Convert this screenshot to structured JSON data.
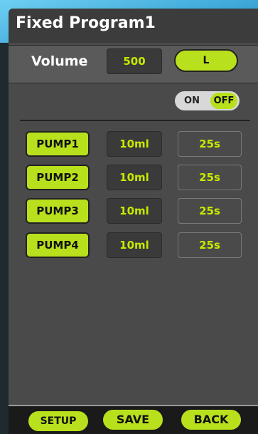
{
  "header": {
    "title": "Fixed Program1"
  },
  "volume": {
    "label": "Volume",
    "value": "500",
    "unit": "L"
  },
  "toggle": {
    "on_label": "ON",
    "off_label": "OFF",
    "state": "OFF"
  },
  "pumps": [
    {
      "label": "PUMP1",
      "volume": "10ml",
      "time": "25s"
    },
    {
      "label": "PUMP2",
      "volume": "10ml",
      "time": "25s"
    },
    {
      "label": "PUMP3",
      "volume": "10ml",
      "time": "25s"
    },
    {
      "label": "PUMP4",
      "volume": "10ml",
      "time": "25s"
    }
  ],
  "footer": {
    "setup_label": "SETUP",
    "save_label": "SAVE",
    "back_label": "BACK"
  },
  "colors": {
    "accent": "#b8e01c",
    "value_text": "#c8e800",
    "panel": "#4a4a4a",
    "header": "#3c3c3c"
  }
}
